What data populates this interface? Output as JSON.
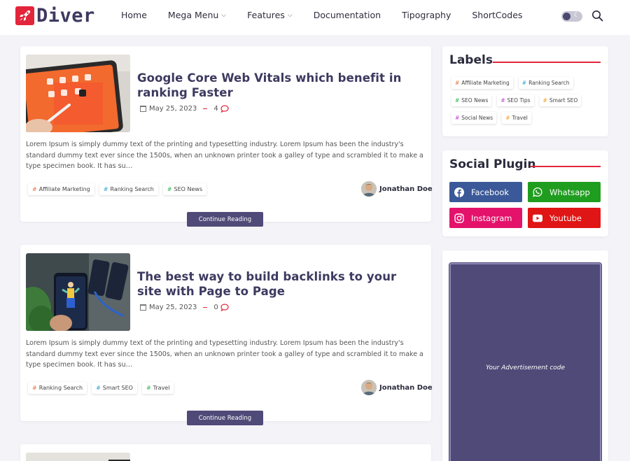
{
  "site": {
    "name": "Diver"
  },
  "nav": {
    "items": [
      {
        "label": "Home",
        "has_dropdown": false
      },
      {
        "label": "Mega Menu",
        "has_dropdown": true
      },
      {
        "label": "Features",
        "has_dropdown": true
      },
      {
        "label": "Documentation",
        "has_dropdown": false
      },
      {
        "label": "Tipography",
        "has_dropdown": false
      },
      {
        "label": "ShortCodes",
        "has_dropdown": false
      }
    ],
    "caret": "⌵",
    "moon_glyph": "☾"
  },
  "posts": [
    {
      "title": "Google Core Web Vitals which benefit in ranking Faster",
      "date": "May 25, 2023",
      "comments": "4",
      "excerpt": "Lorem Ipsum is simply dummy text of the printing and typesetting industry. Lorem Ipsum has been the industry's standard dummy text ever since the 1500s, when an unknown printer took a galley of type and scrambled it to make a type specimen book. It has su…",
      "tags": [
        {
          "label": "Affiliate Marketing",
          "color": "#e8733a"
        },
        {
          "label": "Ranking Search",
          "color": "#2f9fd8"
        },
        {
          "label": "SEO News",
          "color": "#2eb34a"
        }
      ],
      "author": "Jonathan Doe",
      "button": "Continue Reading"
    },
    {
      "title": "The best way to build backlinks to your site with Page to Page",
      "date": "May 25, 2023",
      "comments": "0",
      "excerpt": "Lorem Ipsum is simply dummy text of the printing and typesetting industry. Lorem Ipsum has been the industry's standard dummy text ever since the 1500s, when an unknown printer took a galley of type and scrambled it to make a type specimen book. It has su…",
      "tags": [
        {
          "label": "Ranking Search",
          "color": "#e8733a"
        },
        {
          "label": "Smart SEO",
          "color": "#2f9fd8"
        },
        {
          "label": "Travel",
          "color": "#2eb34a"
        }
      ],
      "author": "Jonathan Doe",
      "button": "Continue Reading"
    }
  ],
  "sidebar": {
    "labels": {
      "title": "Labels",
      "items": [
        {
          "label": "Affiliate Marketing",
          "color": "#e8733a"
        },
        {
          "label": "Ranking Search",
          "color": "#2f9fd8"
        },
        {
          "label": "SEO News",
          "color": "#2eb34a"
        },
        {
          "label": "SEO Tips",
          "color": "#c23bd4"
        },
        {
          "label": "Smart SEO",
          "color": "#f0a020"
        },
        {
          "label": "Social News",
          "color": "#c23bd4"
        },
        {
          "label": "Travel",
          "color": "#f0a020"
        }
      ]
    },
    "social": {
      "title": "Social Plugin",
      "buttons": [
        {
          "label": "Facebook",
          "color": "#3b5998",
          "icon": "facebook-icon"
        },
        {
          "label": "Whatsapp",
          "color": "#1f9d1f",
          "icon": "whatsapp-icon"
        },
        {
          "label": "Instagram",
          "color": "#e4126b",
          "icon": "instagram-icon"
        },
        {
          "label": "Youtube",
          "color": "#e01515",
          "icon": "youtube-icon"
        }
      ]
    },
    "ad": {
      "text": "Your Advertisement code"
    }
  },
  "colors": {
    "accent": "#e3253b",
    "brand": "#4f4a77"
  }
}
